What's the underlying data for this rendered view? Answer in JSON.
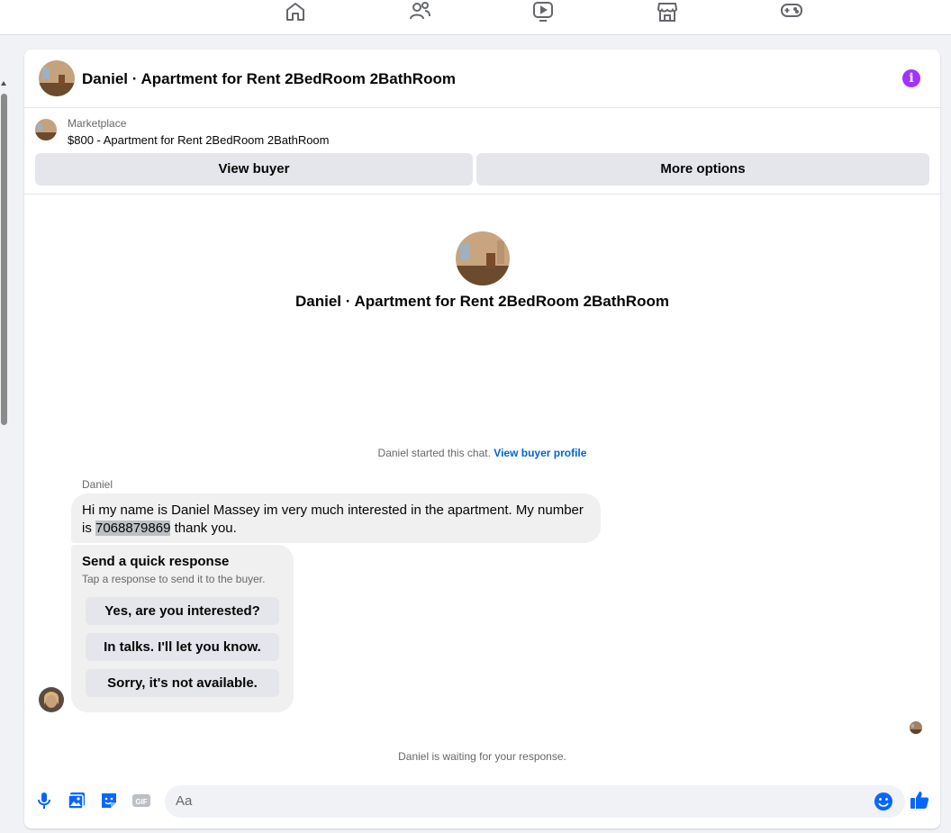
{
  "topnav": {
    "icons": [
      "home-icon",
      "friends-icon",
      "video-icon",
      "marketplace-icon",
      "gaming-icon"
    ]
  },
  "conversation": {
    "title": "Daniel · Apartment for Rent 2BedRoom 2BathRoom",
    "info_icon": "info-icon"
  },
  "marketplace": {
    "label": "Marketplace",
    "listing": "$800 - Apartment for Rent 2BedRoom 2BathRoom",
    "view_buyer": "View buyer",
    "more_options": "More options"
  },
  "intro": {
    "title": "Daniel · Apartment for Rent 2BedRoom 2BathRoom"
  },
  "system": {
    "started_text": "Daniel started this chat.",
    "view_profile": "View buyer profile",
    "waiting": "Daniel is waiting for your response."
  },
  "message": {
    "sender": "Daniel",
    "text_before": "Hi my name is Daniel Massey im very much interested in the apartment. My number is ",
    "phone": "7068879869",
    "text_after": " thank you."
  },
  "quick_response": {
    "title": "Send a quick response",
    "subtitle": "Tap a response to send it to the buyer.",
    "options": [
      "Yes, are you interested?",
      "In talks. I'll let you know.",
      "Sorry, it's not available."
    ]
  },
  "composer": {
    "placeholder": "Aa",
    "icons": [
      "microphone-icon",
      "photo-icon",
      "sticker-icon",
      "gif-icon",
      "emoji-icon",
      "thumbs-up-icon"
    ]
  },
  "colors": {
    "accent": "#0866ff",
    "info": "#a033ff",
    "link": "#0064d1"
  }
}
